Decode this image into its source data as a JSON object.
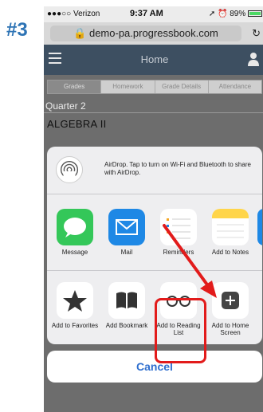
{
  "step_label": "#3",
  "status_bar": {
    "carrier": "●●●○○ Verizon",
    "time": "9:37 AM",
    "battery": "89%"
  },
  "browser": {
    "url": "demo-pa.progressbook.com",
    "reload_icon": "reload-icon"
  },
  "app_header": {
    "title": "Home",
    "menu_icon": "hamburger-icon",
    "user_icon": "user-icon"
  },
  "tabs": [
    "Grades",
    "Homework",
    "Grade Details",
    "Attendance"
  ],
  "page": {
    "quarter": "Quarter 2",
    "course": "ALGEBRA II"
  },
  "share_sheet": {
    "airdrop_text": "AirDrop. Tap to turn on Wi-Fi and Bluetooth to share with AirDrop.",
    "apps": [
      {
        "label": "Message",
        "color": "#34c759"
      },
      {
        "label": "Mail",
        "color": "#1e88e5"
      },
      {
        "label": "Reminders",
        "color": "#ffffff"
      },
      {
        "label": "Add to Notes",
        "color": "#ffd54a"
      }
    ],
    "actions": [
      {
        "label": "Add to Favorites",
        "icon": "star-icon"
      },
      {
        "label": "Add Bookmark",
        "icon": "book-icon"
      },
      {
        "label": "Add to Reading List",
        "icon": "glasses-icon"
      },
      {
        "label": "Add to Home Screen",
        "icon": "plus-square-icon"
      }
    ],
    "cancel_label": "Cancel"
  },
  "annotation_color": "#e21b1b"
}
